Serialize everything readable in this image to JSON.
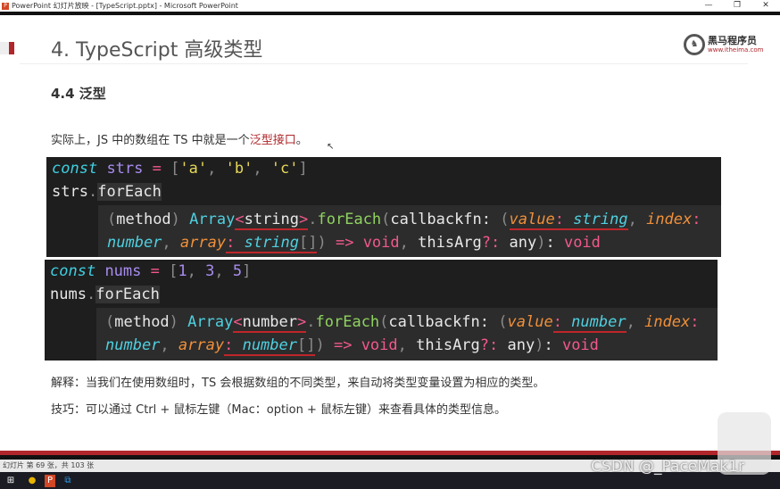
{
  "window": {
    "title": "PowerPoint 幻灯片放映 - [TypeScript.pptx] - Microsoft PowerPoint",
    "controls": [
      "—",
      "❐",
      "✕"
    ]
  },
  "slide": {
    "title": "4. TypeScript 高级类型",
    "logo": {
      "name": "黑马程序员",
      "url": "www.itheima.com"
    },
    "subtitle": "4.4 泛型",
    "intro": {
      "text": "实际上，JS 中的数组在 TS 中就是一个",
      "highlight": "泛型接口",
      "end": "。"
    },
    "code_blocks": [
      {
        "lines": [
          [
            [
              "const",
              "kw"
            ],
            [
              " ",
              "pl"
            ],
            [
              "strs",
              "var"
            ],
            [
              " ",
              "pl"
            ],
            [
              "=",
              "op"
            ],
            [
              " ",
              "pl"
            ],
            [
              "[",
              "pun"
            ],
            [
              "'a'",
              "str"
            ],
            [
              ", ",
              "pun"
            ],
            [
              "'b'",
              "str"
            ],
            [
              ", ",
              "pun"
            ],
            [
              "'c'",
              "str"
            ],
            [
              "]",
              "pun"
            ]
          ],
          [
            [
              "strs",
              "pl"
            ],
            [
              ".",
              "pun"
            ],
            [
              "forEach",
              "pl hlbg"
            ]
          ]
        ],
        "hover": [
          [
            [
              "(",
              "pun"
            ],
            [
              "method",
              "pl"
            ],
            [
              ") ",
              "pun"
            ],
            [
              "Array",
              "type"
            ],
            [
              "<",
              "op u"
            ],
            [
              "string",
              "pl u"
            ],
            [
              ">",
              "op u"
            ],
            [
              ".",
              "pun"
            ],
            [
              "forEach",
              "fn"
            ],
            [
              "(",
              "pun"
            ],
            [
              "callbackfn: ",
              "pl"
            ],
            [
              "(",
              "pun"
            ],
            [
              "value",
              "param u"
            ],
            [
              ":",
              "op u"
            ],
            [
              " string",
              "ti u"
            ],
            [
              ", ",
              "pun"
            ],
            [
              "index",
              "param"
            ],
            [
              ":",
              "op"
            ]
          ],
          [
            [
              "number",
              "ti"
            ],
            [
              ", ",
              "pun"
            ],
            [
              "array",
              "param"
            ],
            [
              ":",
              "op u"
            ],
            [
              " string",
              "ti u"
            ],
            [
              "[]",
              "pun u"
            ],
            [
              ") ",
              "pun"
            ],
            [
              "=>",
              "op"
            ],
            [
              " void",
              "op"
            ],
            [
              ", ",
              "pun"
            ],
            [
              "thisArg",
              "pl"
            ],
            [
              "?:",
              "op"
            ],
            [
              " any",
              "pl"
            ],
            [
              ")",
              "pun"
            ],
            [
              ": ",
              "pl"
            ],
            [
              "void",
              "op"
            ]
          ]
        ]
      },
      {
        "lines": [
          [
            [
              "const",
              "kw"
            ],
            [
              " ",
              "pl"
            ],
            [
              "nums",
              "var"
            ],
            [
              " ",
              "pl"
            ],
            [
              "=",
              "op"
            ],
            [
              " ",
              "pl"
            ],
            [
              "[",
              "pun"
            ],
            [
              "1",
              "num"
            ],
            [
              ", ",
              "pun"
            ],
            [
              "3",
              "num"
            ],
            [
              ", ",
              "pun"
            ],
            [
              "5",
              "num"
            ],
            [
              "]",
              "pun"
            ]
          ],
          [
            [
              "nums",
              "pl"
            ],
            [
              ".",
              "pun"
            ],
            [
              "forEach",
              "pl hlbg"
            ]
          ]
        ],
        "hover": [
          [
            [
              "(",
              "pun"
            ],
            [
              "method",
              "pl"
            ],
            [
              ") ",
              "pun"
            ],
            [
              "Array",
              "type"
            ],
            [
              "<",
              "op u"
            ],
            [
              "number",
              "pl u"
            ],
            [
              ">",
              "op u"
            ],
            [
              ".",
              "pun"
            ],
            [
              "forEach",
              "fn"
            ],
            [
              "(",
              "pun"
            ],
            [
              "callbackfn: ",
              "pl"
            ],
            [
              "(",
              "pun"
            ],
            [
              "value",
              "param"
            ],
            [
              ":",
              "op u"
            ],
            [
              " number",
              "ti u"
            ],
            [
              ", ",
              "pun"
            ],
            [
              "index",
              "param"
            ],
            [
              ":",
              "op"
            ]
          ],
          [
            [
              "number",
              "ti"
            ],
            [
              ", ",
              "pun"
            ],
            [
              "array",
              "param"
            ],
            [
              ":",
              "op u"
            ],
            [
              " number",
              "ti u"
            ],
            [
              "[]",
              "pun u"
            ],
            [
              ") ",
              "pun"
            ],
            [
              "=>",
              "op"
            ],
            [
              " void",
              "op"
            ],
            [
              ", ",
              "pun"
            ],
            [
              "thisArg",
              "pl"
            ],
            [
              "?:",
              "op"
            ],
            [
              " any",
              "pl"
            ],
            [
              ")",
              "pun"
            ],
            [
              ": ",
              "pl"
            ],
            [
              "void",
              "op"
            ]
          ]
        ]
      }
    ],
    "notes": [
      "解释：当我们在使用数组时，TS 会根据数组的不同类型，来自动将类型变量设置为相应的类型。",
      "技巧：可以通过 Ctrl + 鼠标左键（Mac：option + 鼠标左键）来查看具体的类型信息。"
    ]
  },
  "status": "幻灯片 第 69 张，共 103 张",
  "taskbar": {
    "icons": [
      "windows-start",
      "chrome",
      "powerpoint",
      "vscode"
    ]
  },
  "watermark": "CSDN @_PaceMak1r",
  "colors": {
    "accent": "#b0262b",
    "code_bg": "#1e1e1e",
    "hover_bg": "#2c2c2c"
  }
}
